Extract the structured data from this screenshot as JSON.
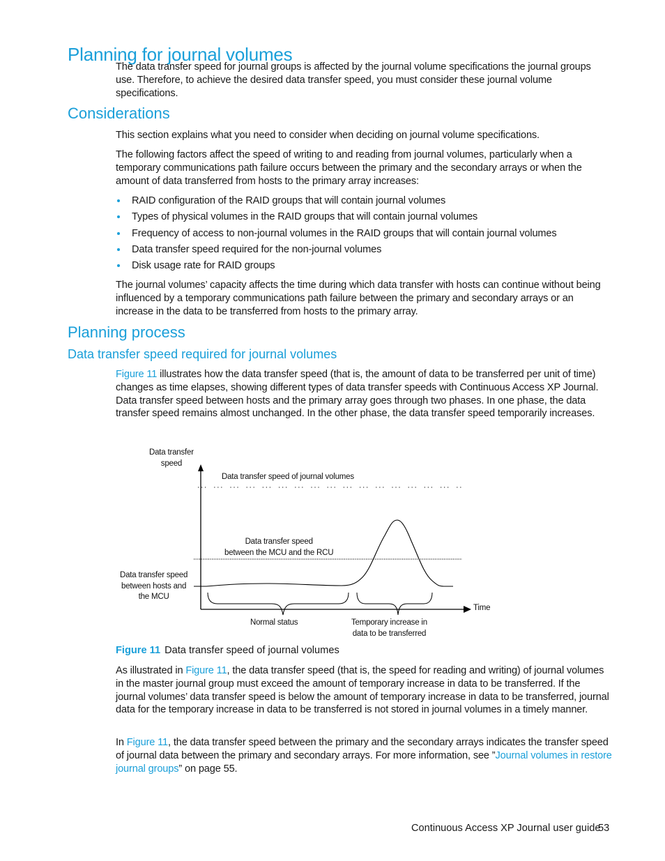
{
  "page": {
    "title": "Planning for journal volumes",
    "intro": "The data transfer speed for journal groups is affected by the journal volume specifications the journal groups use. Therefore, to achieve the desired data transfer speed, you must consider these journal volume specifications.",
    "considerations": {
      "heading": "Considerations",
      "p1": "This section explains what you need to consider when deciding on journal volume specifications.",
      "p2": "The following factors affect the speed of writing to and reading from journal volumes, particularly when a temporary communications path failure occurs between the primary and the secondary arrays or when the amount of data transferred from hosts to the primary array increases:",
      "bullets": [
        "RAID configuration of the RAID groups that will contain journal volumes",
        "Types of physical volumes in the RAID groups that will contain journal volumes",
        "Frequency of access to non-journal volumes in the RAID groups that will contain journal volumes",
        "Data transfer speed required for the non-journal volumes",
        "Disk usage rate for RAID groups"
      ],
      "p3": "The journal volumes’ capacity affects the time during which data transfer with hosts can continue without being influenced by a temporary communications path failure between the primary and secondary arrays or an increase in the data to be transferred from hosts to the primary array."
    },
    "planning": {
      "heading": "Planning process",
      "subheading": "Data transfer speed required for journal volumes",
      "p1_link": "Figure 11",
      "p1_rest": " illustrates how the data transfer speed (that is, the amount of data to be transferred per unit of time) changes as time elapses, showing different types of data transfer speeds with Continuous Access XP Journal. Data transfer speed between hosts and the primary array goes through two phases. In one phase, the data transfer speed remains almost unchanged. In the other phase, the data transfer speed temporarily increases.",
      "figure": {
        "y_axis_label_line1": "Data transfer",
        "y_axis_label_line2": "speed",
        "x_axis_label": "Time",
        "journal_line_label": "Data transfer speed of journal volumes",
        "mcu_rcu_label_line1": "Data transfer speed",
        "mcu_rcu_label_line2": "between the MCU and the RCU",
        "hosts_label_line1": "Data transfer speed",
        "hosts_label_line2": "between hosts and",
        "hosts_label_line3": "the MCU",
        "normal_label": "Normal status",
        "temp_label_line1": "Temporary increase in",
        "temp_label_line2": "data to be transferred"
      },
      "caption_num": "Figure 11",
      "caption_text": "Data transfer speed of journal volumes",
      "p2_pre": "As illustrated in ",
      "p2_link": "Figure 11",
      "p2_rest": ", the data transfer speed (that is, the speed for reading and writing) of journal volumes in the master journal group must exceed the amount of temporary increase in data to be transferred. If the journal volumes’ data transfer speed is below the amount of temporary increase in data to be transferred, journal data for the temporary increase in data to be transferred is not stored in journal volumes in a timely manner.",
      "p3_pre": "In ",
      "p3_link": "Figure 11",
      "p3_mid": ", the data transfer speed between the primary and the secondary arrays indicates the transfer speed of journal data between the primary and secondary arrays. For more information, see ”",
      "p3_link2": "Journal volumes in restore journal groups",
      "p3_post": "” on page 55."
    }
  },
  "footer": {
    "guide_title": "Continuous Access XP Journal user guide",
    "page_number": "53"
  },
  "colors": {
    "heading": "#1a9fd9",
    "link": "#1a9fd9",
    "text": "#1a1a1a"
  }
}
